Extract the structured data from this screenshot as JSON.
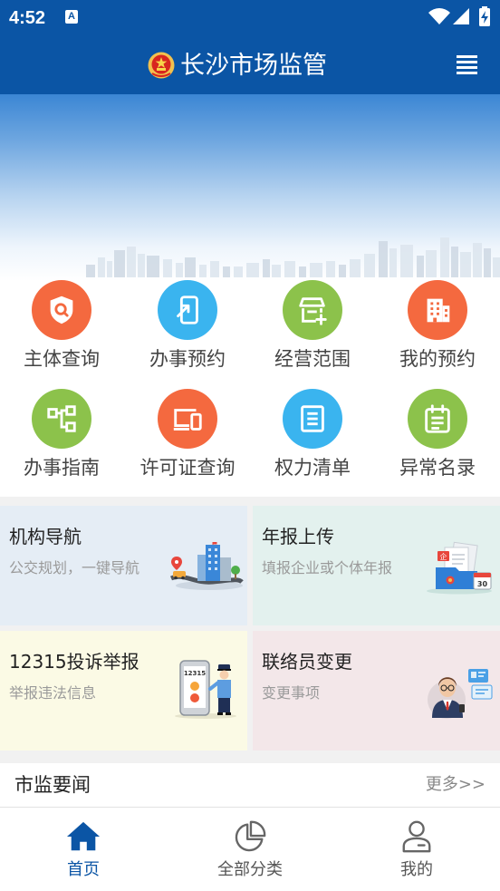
{
  "status_bar": {
    "time": "4:52",
    "notification_glyph": "A"
  },
  "header": {
    "title": "长沙市场监管",
    "emblem_icon": "national-emblem-icon",
    "menu_icon": "menu-icon"
  },
  "colors": {
    "primary": "#0b55a5",
    "orange": "#f4693f",
    "blue": "#3ab4ef",
    "green": "#8cc24b"
  },
  "services": [
    {
      "label": "主体查询",
      "icon": "shield-search-icon",
      "color": "#f4693f"
    },
    {
      "label": "办事预约",
      "icon": "phone-arrow-icon",
      "color": "#3ab4ef"
    },
    {
      "label": "经营范围",
      "icon": "store-plus-icon",
      "color": "#8cc24b"
    },
    {
      "label": "我的预约",
      "icon": "building-icon",
      "color": "#f4693f"
    },
    {
      "label": "办事指南",
      "icon": "flowchart-icon",
      "color": "#8cc24b"
    },
    {
      "label": "许可证查询",
      "icon": "license-device-icon",
      "color": "#f4693f"
    },
    {
      "label": "权力清单",
      "icon": "list-document-icon",
      "color": "#3ab4ef"
    },
    {
      "label": "异常名录",
      "icon": "calendar-list-icon",
      "color": "#8cc24b"
    }
  ],
  "cards": [
    {
      "title": "机构导航",
      "subtitle": "公交规划，一键导航",
      "bg": "#e5edf5",
      "illustration": "city-navigation-illustration"
    },
    {
      "title": "年报上传",
      "subtitle": "填报企业或个体年报",
      "bg": "#e3f1ee",
      "illustration": "annual-report-illustration",
      "tag": "企",
      "calendar_day": "30"
    },
    {
      "title": "12315投诉举报",
      "subtitle": "举报违法信息",
      "bg": "#fbfae5",
      "illustration": "complaint-hotline-illustration",
      "phone_text": "12315"
    },
    {
      "title": "联络员变更",
      "subtitle": "变更事项",
      "bg": "#f3e7e9",
      "illustration": "liaison-officer-illustration"
    }
  ],
  "news": {
    "title": "市监要闻",
    "more": "更多>>"
  },
  "bottom_nav": {
    "items": [
      {
        "label": "首页",
        "icon": "home-icon",
        "active": true
      },
      {
        "label": "全部分类",
        "icon": "pie-chart-icon",
        "active": false
      },
      {
        "label": "我的",
        "icon": "person-icon",
        "active": false
      }
    ]
  }
}
